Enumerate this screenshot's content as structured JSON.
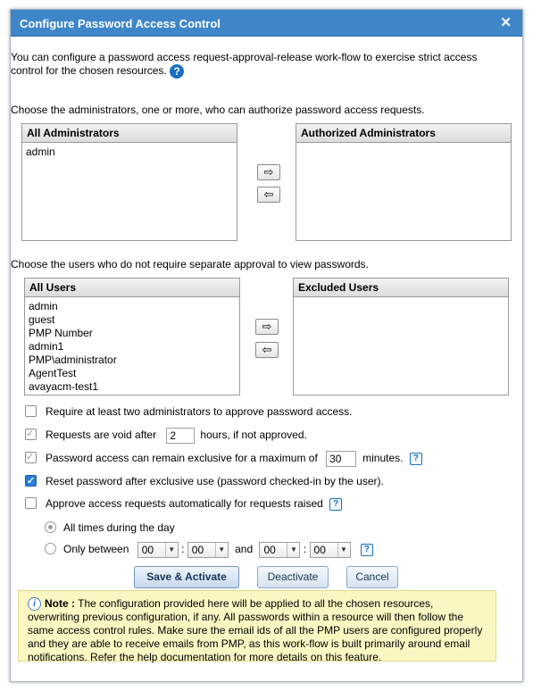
{
  "dialog": {
    "title": "Configure Password Access Control",
    "close_icon": "close-icon",
    "intro": "You can configure a password access request-approval-release work-flow to exercise strict access control for the chosen resources.",
    "help_glyph": "?"
  },
  "admins": {
    "label": "Choose the administrators, one or more, who can authorize password access requests.",
    "all_header": "All Administrators",
    "all_items": [
      "admin"
    ],
    "authorized_header": "Authorized Administrators",
    "authorized_items": []
  },
  "users": {
    "label": "Choose the users who do not require separate approval to view passwords.",
    "all_header": "All Users",
    "all_items": [
      "admin",
      "guest",
      "PMP Number",
      "admin1",
      "PMP\\administrator",
      "AgentTest",
      "avayacm-test1"
    ],
    "excluded_header": "Excluded Users",
    "excluded_items": []
  },
  "arrows": {
    "right": "⇨",
    "left": "⇦"
  },
  "options": {
    "two_admins": {
      "label": "Require at least two administrators to approve password access.",
      "checked": false
    },
    "void": {
      "label_pre": "Requests are void after",
      "value": "2",
      "label_post": "hours, if not approved.",
      "checked": true
    },
    "exclusive": {
      "label_pre": "Password access can remain exclusive for a maximum of",
      "value": "30",
      "label_post": "minutes.",
      "checked": true
    },
    "reset": {
      "label": "Reset password after exclusive use (password checked-in by the user).",
      "checked": true
    },
    "auto_approve": {
      "label": "Approve access requests automatically for requests raised",
      "checked": false
    },
    "all_times": {
      "label": "All times during the day",
      "selected": true
    },
    "between": {
      "label": "Only between",
      "start_hour": "00",
      "start_min": "00",
      "and_label": "and",
      "end_hour": "00",
      "end_min": "00",
      "colon": ":",
      "selected": false
    }
  },
  "buttons": {
    "save": "Save & Activate",
    "deactivate": "Deactivate",
    "cancel": "Cancel"
  },
  "note": {
    "icon": "i",
    "heading": "Note :",
    "text": "The configuration provided here will be applied to all the chosen resources, overwriting previous configuration, if any. All passwords within a resource will then follow the same access control rules. Make sure the email ids of all the PMP users are configured properly and they are able to receive emails from PMP, as this work-flow is built primarily around email notifications. Refer the help documentation for more details on this feature."
  },
  "colors": {
    "title_bar": "#3f86c9",
    "note_bg": "#fbf7c2",
    "accent": "#1a6fc0"
  }
}
